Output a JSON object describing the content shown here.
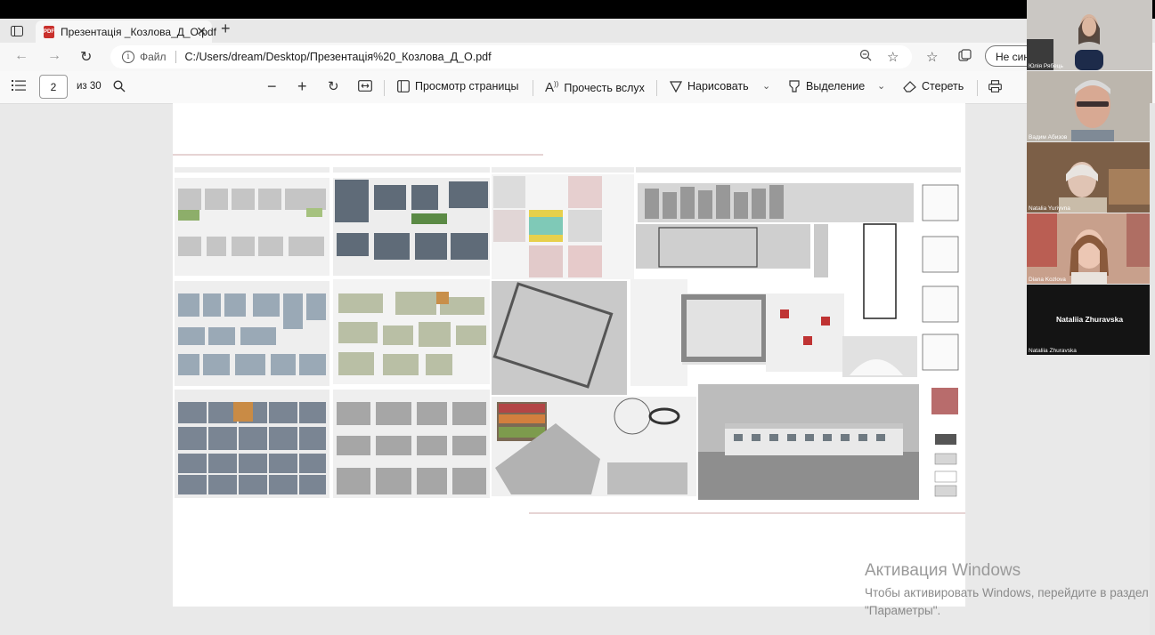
{
  "browser": {
    "tab": {
      "title": "Презентація _Козлова_Д_О.pdf",
      "icon": "pdf-icon",
      "badge": "PDF"
    },
    "address": {
      "scheme_label": "Файл",
      "url": "C:/Users/dream/Desktop/Презентація%20_Козлова_Д_О.pdf"
    },
    "sync_button": "Не синх"
  },
  "pdf_toolbar": {
    "page_current": "2",
    "page_total": "из 30",
    "page_view": "Просмотр страницы",
    "read_aloud": "Прочесть вслух",
    "draw": "Нарисовать",
    "highlight": "Выделение",
    "erase": "Стереть"
  },
  "participants": [
    {
      "name": "Юлія Рябець",
      "bg": "#c9c6c4"
    },
    {
      "name": "Вадим Абизов",
      "bg": "#b9b1a8"
    },
    {
      "name": "Natalia Yuriyvna",
      "bg": "#8a6c52"
    },
    {
      "name": "Diana Kozlova",
      "bg": "#c6a594"
    },
    {
      "name": "Nataliia Zhuravska",
      "display_name": "Nataliia Zhuravska",
      "bg": "#141414"
    }
  ],
  "watermark": {
    "title": "Активация Windows",
    "text": "Чтобы активировать Windows, перейдите в раздел \"Параметры\"."
  },
  "colors": {
    "accent_red": "#c9302c",
    "page_bg": "#e9e9e9",
    "top_band": "#000000"
  }
}
